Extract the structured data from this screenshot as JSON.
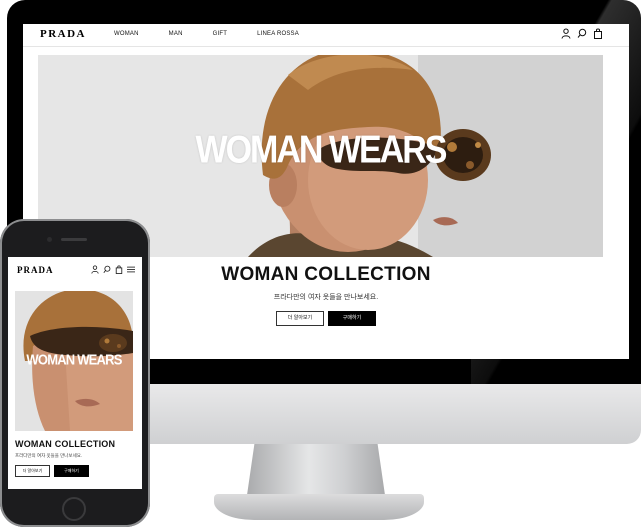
{
  "brand": "PRADA",
  "desktop": {
    "nav": {
      "items": [
        {
          "label": "WOMAN"
        },
        {
          "label": "MAN"
        },
        {
          "label": "GIFT"
        },
        {
          "label": "LINEA ROSSA"
        }
      ],
      "icons": [
        "user-icon",
        "search-icon",
        "shopping-bag-icon"
      ]
    },
    "hero": {
      "title": "WOMAN WEARS"
    },
    "section": {
      "heading": "WOMAN COLLECTION",
      "subtext": "프라다만의 여자 옷들을 만나보세요.",
      "more_button": "더 알아보기",
      "buy_button": "구매하기"
    }
  },
  "mobile": {
    "icons": [
      "user-icon",
      "search-icon",
      "shopping-bag-icon",
      "menu-icon"
    ],
    "hero": {
      "title": "WOMAN WEARS"
    },
    "section": {
      "heading": "WOMAN COLLECTION",
      "subtext": "프라다만의 여자 옷들을 만나보세요.",
      "more_button": "더 알아보기",
      "buy_button": "구매하기"
    }
  },
  "colors": {
    "brand_black": "#000000",
    "button_filled": "#000000",
    "page_background": "#ffffff"
  }
}
